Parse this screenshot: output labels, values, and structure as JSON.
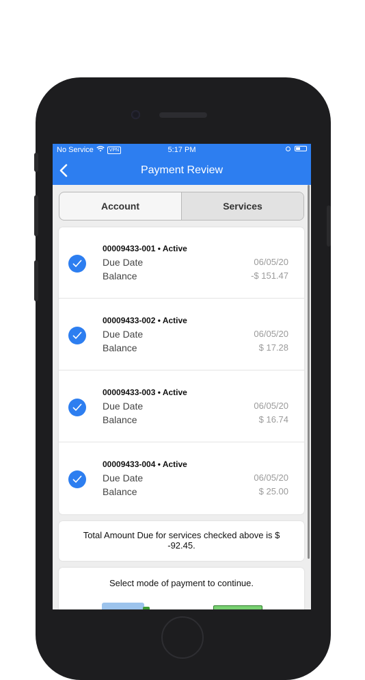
{
  "status_bar": {
    "carrier": "No Service",
    "vpn": "VPN",
    "time": "5:17 PM"
  },
  "nav": {
    "title": "Payment Review",
    "back_icon": "chevron-left-icon"
  },
  "segments": {
    "account": "Account",
    "services": "Services",
    "selected": "Services"
  },
  "services": [
    {
      "account": "00009433-001 • Active",
      "due_label": "Due Date",
      "due_date": "06/05/20",
      "balance_label": "Balance",
      "balance": "-$ 151.47",
      "checked": true
    },
    {
      "account": "00009433-002 • Active",
      "due_label": "Due Date",
      "due_date": "06/05/20",
      "balance_label": "Balance",
      "balance": "$ 17.28",
      "checked": true
    },
    {
      "account": "00009433-003 • Active",
      "due_label": "Due Date",
      "due_date": "06/05/20",
      "balance_label": "Balance",
      "balance": "$ 16.74",
      "checked": true
    },
    {
      "account": "00009433-004 • Active",
      "due_label": "Due Date",
      "due_date": "06/05/20",
      "balance_label": "Balance",
      "balance": "$ 25.00",
      "checked": true
    }
  ],
  "total": {
    "text": "Total Amount Due for services checked above is $ -92.45."
  },
  "payment": {
    "prompt": "Select mode of payment to continue.",
    "options": [
      "credit-card-icon",
      "check-icon"
    ]
  },
  "colors": {
    "accent": "#2d7ef0",
    "background": "#eeeeee"
  }
}
